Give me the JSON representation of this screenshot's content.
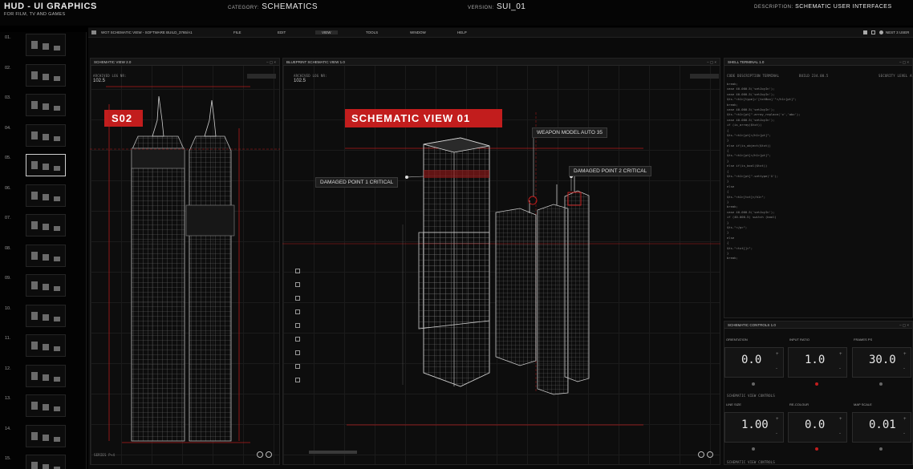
{
  "header": {
    "brand": "HUD - UI GRAPHICS",
    "brand_sub": "FOR FILM, TV AND GAMES",
    "category_key": "CATEGORY:",
    "category_val": "SCHEMATICS",
    "version_key": "VERSION:",
    "version_val": "SUI_01",
    "desc_key": "DESCRIPTION:",
    "desc_val": "SCHEMATIC USER INTERFACES"
  },
  "sidebar": {
    "numbers": [
      "01.",
      "02.",
      "03.",
      "04.",
      "05.",
      "06.",
      "07.",
      "08.",
      "09.",
      "10.",
      "11.",
      "12.",
      "13.",
      "14.",
      "15."
    ],
    "selected_index": 4
  },
  "menubar": {
    "window_title": "WGT SCHEMATIC VIEW - SOFTWARE BUILD_3765/A1",
    "items": [
      "FILE",
      "EDIT",
      "VIEW",
      "TOOLS",
      "WINDOW",
      "HELP"
    ],
    "right_text": "NEST 3 USER"
  },
  "left_panel": {
    "title": "SCHEMATIC VIEW 2.0",
    "archived_label": "ARCHIVED LOG NR:",
    "archived_val": "102.5",
    "badge": "S02",
    "bottom_label": "SERIES P+4"
  },
  "center_panel": {
    "title": "BLUEPRINT SCHEMATIC VIEW 1.0",
    "archived_label": "ARCHIVED LOG NR:",
    "archived_val": "102.5",
    "badge": "SCHEMATIC VIEW 01",
    "callout_weapon": "WEAPON MODEL AUTO 35",
    "callout_damage1": "DAMAGED POINT 1 CRITICAL",
    "callout_damage2": "DAMAGED POINT 2 CRITICAL"
  },
  "terminal": {
    "title": "SHELL TERMINAL 1.0",
    "sub_left": "CODE DESCRIPTION TERMINAL",
    "sub_mid": "BUILD 234.00.5",
    "sub_right": "SECURITY LEVEL A",
    "lines": [
      "break;",
      "case 40.000.5('setJoyIn');",
      "case 40.000.5('setJoyIn');",
      "$ts.\"<h1>[type]='[txtBox]'\"</h1>[pt]\";",
      "break;",
      "case 40.000.5('setJoyIn');",
      "$ts.\"<h1>[pt]\".array_replace('x','abc');",
      "case 40.000.5('setJoyIn');",
      "if (is_array($txt))",
      "{",
      "$ts.\"<h1>[pt]</h1>[pt]\";",
      "}",
      "else if(is_object($txt))",
      "{",
      "$ts.\"<h1>[pt]</h1>[pt]\";",
      "}",
      "else if(is_bool($txt))",
      "{",
      "$ts.\"<h1>[pt]\".settype('X');",
      "}",
      "else",
      "{",
      "$ts.\"<h1>[txt]</h1>\";",
      "}",
      "break;",
      "case 40.000.5('setJoyIn');",
      "if (40.000.5) switch (bool)",
      "}",
      "$ts.\"</p>\";",
      "}",
      "else",
      "{",
      "$ts.\"<txt[]>\";",
      "}",
      "break;"
    ]
  },
  "controls": {
    "title": "SCHEMATIC CONTROLS 1.0",
    "row1": [
      {
        "label": "ORIENTATION",
        "value": "0.0"
      },
      {
        "label": "INPUT RATIO",
        "value": "1.0"
      },
      {
        "label": "FRAMES PS",
        "value": "30.0"
      }
    ],
    "mid_label": "SCHEMATIC VIEW CONTROLS",
    "row2": [
      {
        "label": "LINE SIZE",
        "value": "1.00"
      },
      {
        "label": "RE-COLOUR",
        "value": "0.0"
      },
      {
        "label": "MAP SCALE",
        "value": "0.01"
      }
    ],
    "bottom_label": "SCHEMATIC VIEW CONTROLS"
  },
  "colors": {
    "accent": "#c21d1d",
    "bg": "#0a0a0a"
  }
}
